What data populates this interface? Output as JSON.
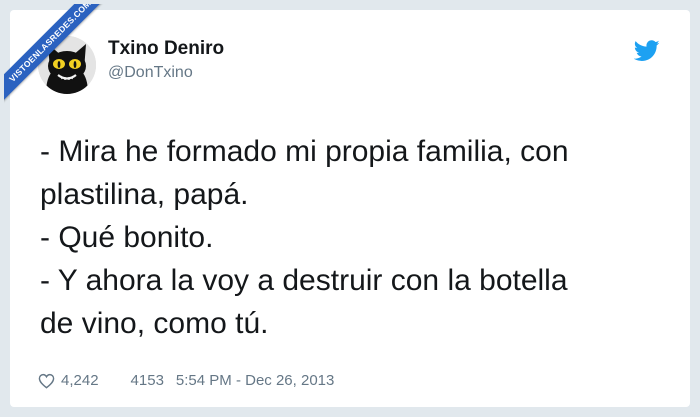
{
  "watermark": {
    "text": "VISTOENLASREDES.COM"
  },
  "tweet": {
    "display_name": "Txino Deniro",
    "handle": "@DonTxino",
    "text": "- Mira he formado mi propia familia, con\nplastilina, papá.\n- Qué bonito.\n- Y ahora la voy a destruir con la botella\nde vino, como tú.",
    "likes": "4,242",
    "retweets": "4153",
    "timestamp": "5:54 PM - Dec 26, 2013"
  },
  "colors": {
    "twitter_blue": "#1da1f2",
    "text": "#14171a",
    "muted": "#657786",
    "ribbon": "#2b62c0"
  },
  "icons": {
    "bird": "twitter-bird-icon",
    "like": "heart-icon",
    "avatar": "black-cat-avatar"
  }
}
